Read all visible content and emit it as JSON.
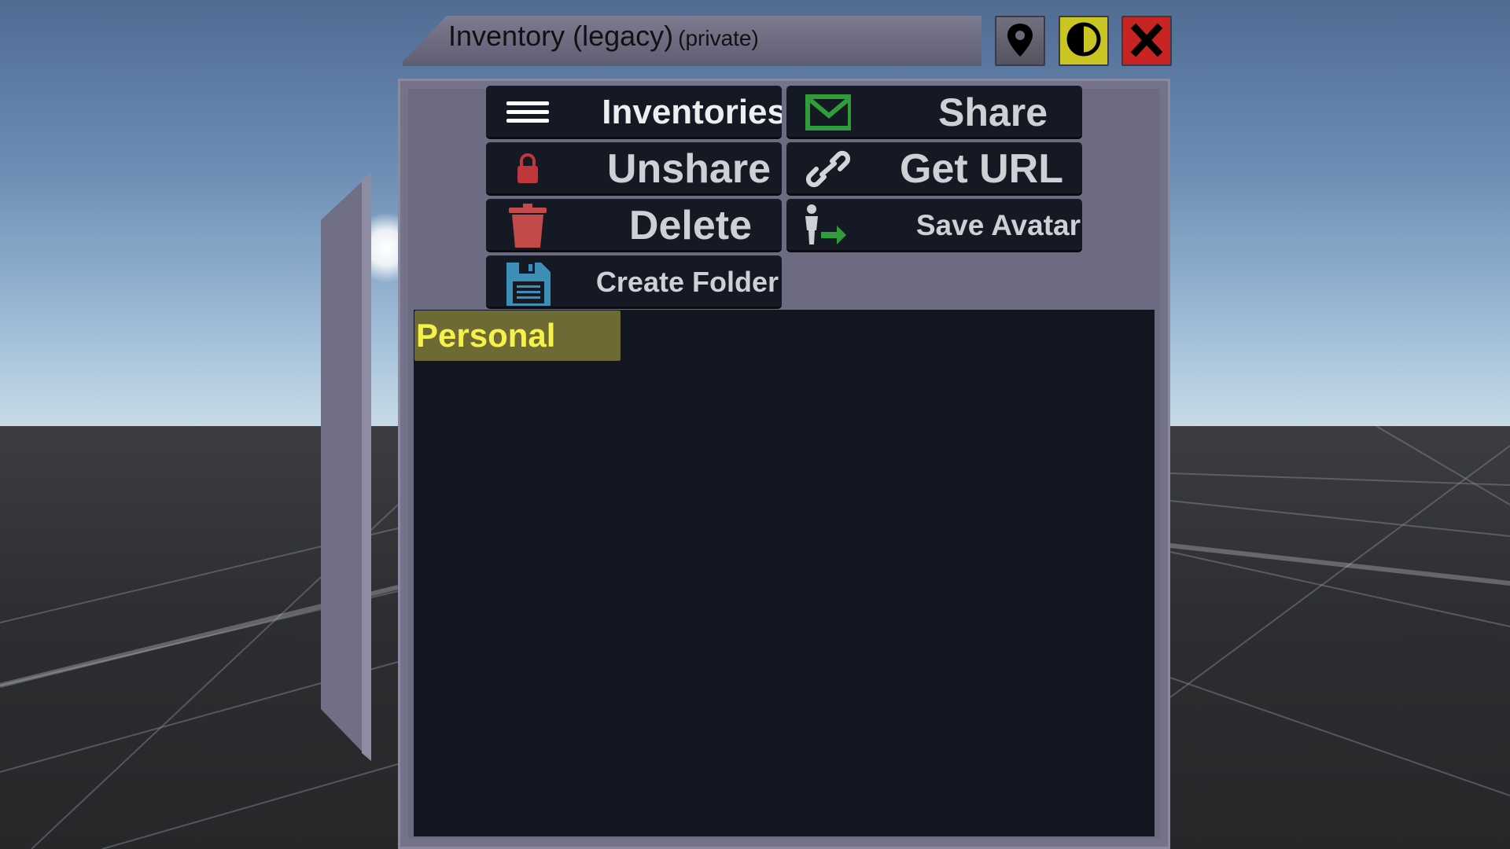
{
  "window": {
    "title": "Inventory (legacy)",
    "subtitle": "(private)"
  },
  "title_buttons": [
    {
      "icon": "map-pin-icon"
    },
    {
      "icon": "contrast-icon",
      "color": "#c9c624"
    },
    {
      "icon": "close-icon",
      "color": "#c82424"
    }
  ],
  "toolbar": {
    "inventories_label": "Inventories",
    "share_label": "Share",
    "unshare_label": "Unshare",
    "get_url_label": "Get URL",
    "delete_label": "Delete",
    "save_avatar_label": "Save Avatar",
    "create_folder_label": "Create Folder"
  },
  "icons": {
    "inventories": "hamburger-menu-icon",
    "share": "envelope-icon",
    "unshare": "lock-icon",
    "get_url": "link-icon",
    "delete": "trash-icon",
    "save_avatar": "avatar-arrow-icon",
    "create_folder": "floppy-disk-icon"
  },
  "folders": [
    {
      "label": "Personal",
      "selected": true
    }
  ],
  "colors": {
    "panel": "#6d6b82",
    "button_bg": "#151923",
    "button_text": "#dddde0",
    "content_bg": "#121620",
    "selected_bg": "#6e6a35",
    "selected_text": "#f4f24a",
    "share_icon": "#2f9e3a",
    "unshare_icon": "#c0373b",
    "delete_icon": "#c24a48",
    "folder_icon": "#3e8fb8"
  }
}
